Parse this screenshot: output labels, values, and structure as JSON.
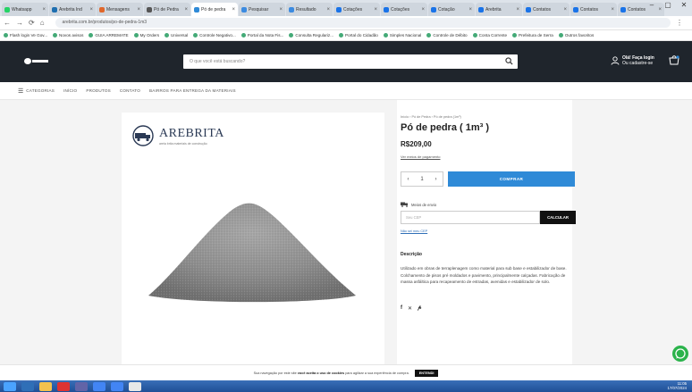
{
  "browser": {
    "tabs": [
      {
        "label": "Whatsapp",
        "color": "#25d366",
        "active": false
      },
      {
        "label": "Arebrita Ind",
        "color": "#1f6fb0",
        "active": false
      },
      {
        "label": "Mensagens",
        "color": "#e0672b",
        "active": false
      },
      {
        "label": "Pó de Pedra",
        "color": "#555555",
        "active": false
      },
      {
        "label": "Pó de pedra",
        "color": "#2f8ad7",
        "active": true
      },
      {
        "label": "Pesquisar",
        "color": "#3c8be0",
        "active": false
      },
      {
        "label": "Resultado",
        "color": "#3c8be0",
        "active": false
      },
      {
        "label": "Cotações",
        "color": "#1a73e8",
        "active": false
      },
      {
        "label": "Cotações",
        "color": "#1a73e8",
        "active": false
      },
      {
        "label": "Cotação",
        "color": "#1a73e8",
        "active": false
      },
      {
        "label": "Arebrita",
        "color": "#1a73e8",
        "active": false
      },
      {
        "label": "Contatos",
        "color": "#1a73e8",
        "active": false
      },
      {
        "label": "Contatos",
        "color": "#1a73e8",
        "active": false
      },
      {
        "label": "Contatos",
        "color": "#1a73e8",
        "active": false
      }
    ],
    "url": "arebrita.com.br/produtos/po-de-pedra-1m3",
    "bookmarks": [
      "Flash login Ve Gov...",
      "Novos avisos",
      "GUIA ARREMATE",
      "My Orders",
      "Universal",
      "Controle Negativo...",
      "Portal da Nota Fis...",
      "Consulta Regulariz...",
      "Portal do Cidadão",
      "Simples Nacional",
      "Controle de Débito",
      "Conta Corrente",
      "Prefeitura de Serra",
      "Outros favoritos"
    ]
  },
  "header": {
    "search_placeholder": "O que você está buscando?",
    "login_line1": "Olá! Faça login",
    "login_line2": "Ou cadastre-se"
  },
  "nav": {
    "items": [
      "CATEGORIAS",
      "INÍCIO",
      "PRODUTOS",
      "CONTATO",
      "BAIRROS PARA ENTREGA DA MATERIAIS"
    ]
  },
  "brand": {
    "name": "AREBRITA",
    "tagline": "areia brita materiais de construção"
  },
  "product": {
    "breadcrumb": "Início › Pó de Pedra › Pó de pedra (1m³)",
    "title": "Pó de pedra ( 1m³ )",
    "price": "R$209,00",
    "installments": "Ver meios de pagamento",
    "qty_minus": "‹",
    "qty_value": "1",
    "qty_plus": "›",
    "buy_label": "COMPRAR",
    "shipping_label": "Meios de envio",
    "cep_placeholder": "Seu CEP",
    "calc_label": "CALCULAR",
    "no_cep": "Não sei meu CEP",
    "desc_title": "Descrição",
    "description": "Utilizado em obras de terraplenagem como material para sub base e estabilizador de base. Colchamento de pisos pré moldados e pavimento, principalmente calçadas. Fabricação de massa asfáltica para recapeamento de estradas, avenidas e estabilizador de solo.",
    "share_icons": [
      "facebook-icon",
      "x-icon",
      "pinterest-icon"
    ]
  },
  "cookie": {
    "text_a": "Sua navegação por este site",
    "text_b": "você aceita o uso de cookies",
    "text_c": "para agilizar a sua experiência de compra.",
    "ok": "ENTENDI"
  },
  "taskbar": {
    "icons": [
      "start-icon",
      "explorer-icon",
      "files-icon",
      "vpn-icon",
      "teams-icon",
      "chrome-icon",
      "chrome-icon",
      "app-icon"
    ],
    "time": "11:05",
    "date": "17/07/2024"
  },
  "colors": {
    "header_bg": "#1f252c",
    "buy_button": "#2f8ad7",
    "whatsapp": "#2bb34b"
  }
}
